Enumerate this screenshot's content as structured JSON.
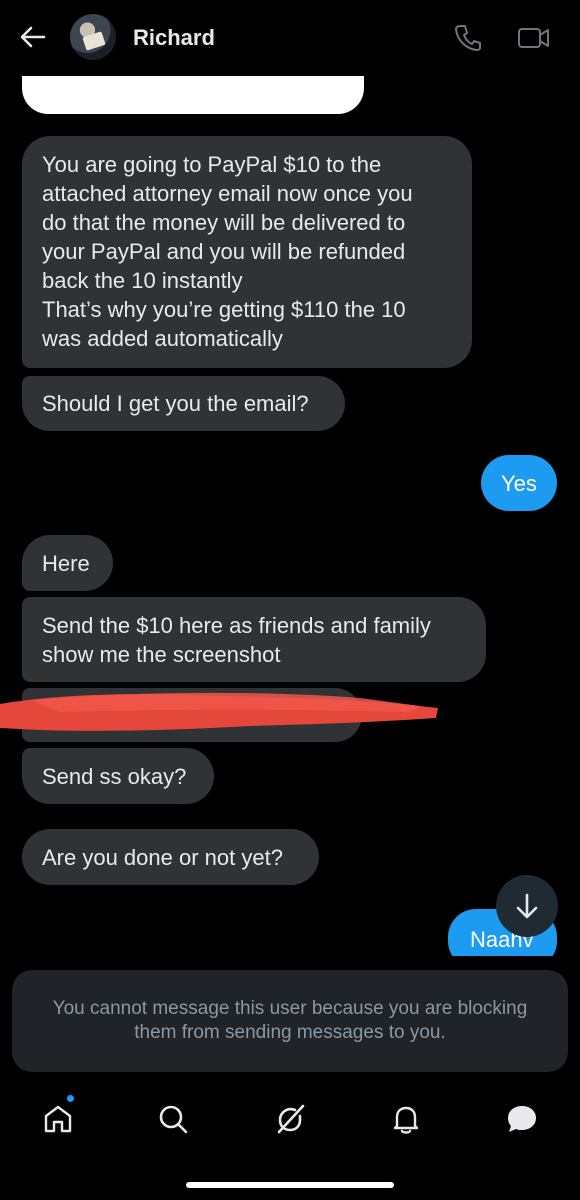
{
  "header": {
    "title": "Richard",
    "back_icon": "arrow-left-icon",
    "call_icon": "phone-icon",
    "video_icon": "video-camera-icon"
  },
  "messages": [
    {
      "direction": "incoming",
      "text": "You are going to PayPal $10 to the\nattached attorney email now once you\ndo that the money will be delivered to\nyour PayPal and you will be refunded\nback the 10 instantly\nThat’s why you’re getting $110 the 10\nwas added automatically"
    },
    {
      "direction": "incoming",
      "text": "Should I get you the email?"
    },
    {
      "direction": "outgoing",
      "text": "Yes"
    },
    {
      "direction": "incoming",
      "text": "Here"
    },
    {
      "direction": "incoming",
      "text": "Send the $10 here as friends and family\nshow me the screenshot"
    },
    {
      "direction": "incoming",
      "text": "",
      "redacted": true
    },
    {
      "direction": "incoming",
      "text": "Send ss okay?"
    },
    {
      "direction": "incoming",
      "text": "Are you done or not yet?"
    },
    {
      "direction": "outgoing",
      "text": "Naahv"
    }
  ],
  "blocked_notice": "You cannot message this user because you are blocking them from sending messages to you.",
  "tabbar": {
    "items": [
      "home-icon",
      "search-icon",
      "grok-icon",
      "notifications-bell-icon",
      "messages-icon"
    ],
    "active": "messages-icon"
  },
  "colors": {
    "background": "#000000",
    "incoming_bubble": "#2f3336",
    "outgoing_bubble": "#1d9bf0",
    "redaction_mark": "#e5483a",
    "notice_text": "#8b98a5"
  }
}
